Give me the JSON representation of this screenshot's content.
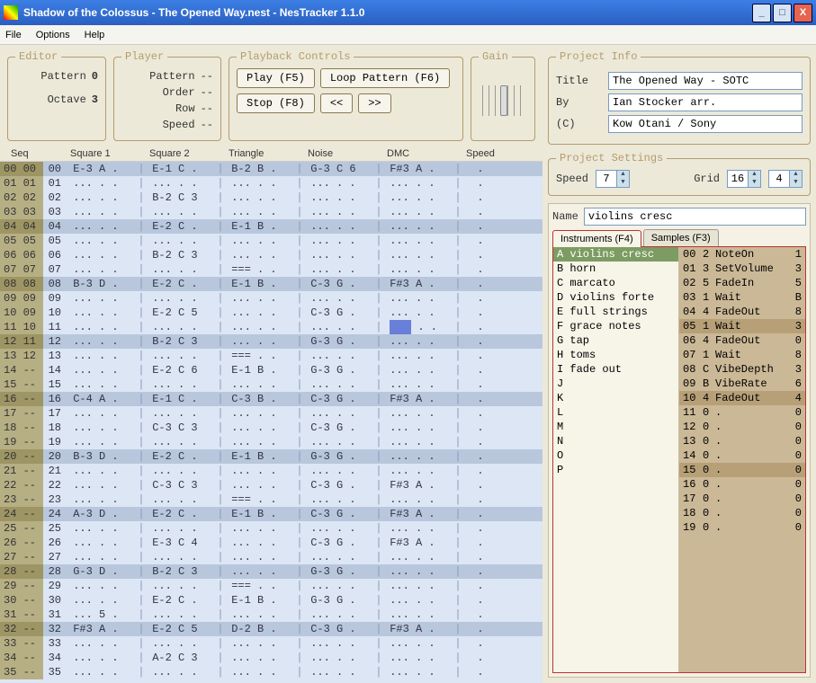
{
  "window": {
    "title": "Shadow of the Colossus - The Opened Way.nest - NesTracker 1.1.0"
  },
  "menu": {
    "file": "File",
    "options": "Options",
    "help": "Help"
  },
  "editor": {
    "legend": "Editor",
    "pattern_lbl": "Pattern",
    "pattern_val": "0",
    "octave_lbl": "Octave",
    "octave_val": "3"
  },
  "player": {
    "legend": "Player",
    "pattern_lbl": "Pattern",
    "pattern_val": "--",
    "order_lbl": "Order",
    "order_val": "--",
    "row_lbl": "Row",
    "row_val": "--",
    "speed_lbl": "Speed",
    "speed_val": "--"
  },
  "playback": {
    "legend": "Playback Controls",
    "play": "Play (F5)",
    "loop": "Loop Pattern (F6)",
    "stop": "Stop (F8)",
    "prev": "<<",
    "next": ">>"
  },
  "gain": {
    "legend": "Gain"
  },
  "columns": {
    "seq": "Seq",
    "sq1": "Square 1",
    "sq2": "Square 2",
    "tri": "Triangle",
    "noise": "Noise",
    "dmc": "DMC",
    "speed": "Speed"
  },
  "rows": [
    {
      "hl": 1,
      "seq": "00 00",
      "idx": "00",
      "sq1": "E-3 A .",
      "sq2": "E-1 C .",
      "tri": "B-2 B .",
      "noi": "G-3 C 6",
      "dmc": "F#3 A .",
      "sp": "."
    },
    {
      "hl": 0,
      "seq": "01 01",
      "idx": "01",
      "sq1": "... . .",
      "sq2": "... . .",
      "tri": "... . .",
      "noi": "... . .",
      "dmc": "... . .",
      "sp": "."
    },
    {
      "hl": 0,
      "seq": "02 02",
      "idx": "02",
      "sq1": "... . .",
      "sq2": "B-2 C 3",
      "tri": "... . .",
      "noi": "... . .",
      "dmc": "... . .",
      "sp": "."
    },
    {
      "hl": 0,
      "seq": "03 03",
      "idx": "03",
      "sq1": "... . .",
      "sq2": "... . .",
      "tri": "... . .",
      "noi": "... . .",
      "dmc": "... . .",
      "sp": "."
    },
    {
      "hl": 1,
      "seq": "04 04",
      "idx": "04",
      "sq1": "... . .",
      "sq2": "E-2 C .",
      "tri": "E-1 B .",
      "noi": "... . .",
      "dmc": "... . .",
      "sp": "."
    },
    {
      "hl": 0,
      "seq": "05 05",
      "idx": "05",
      "sq1": "... . .",
      "sq2": "... . .",
      "tri": "... . .",
      "noi": "... . .",
      "dmc": "... . .",
      "sp": "."
    },
    {
      "hl": 0,
      "seq": "06 06",
      "idx": "06",
      "sq1": "... . .",
      "sq2": "B-2 C 3",
      "tri": "... . .",
      "noi": "... . .",
      "dmc": "... . .",
      "sp": "."
    },
    {
      "hl": 0,
      "seq": "07 07",
      "idx": "07",
      "sq1": "... . .",
      "sq2": "... . .",
      "tri": "=== . .",
      "noi": "... . .",
      "dmc": "... . .",
      "sp": "."
    },
    {
      "hl": 1,
      "seq": "08 08",
      "idx": "08",
      "sq1": "B-3 D .",
      "sq2": "E-2 C .",
      "tri": "E-1 B .",
      "noi": "C-3 G .",
      "dmc": "F#3 A .",
      "sp": "."
    },
    {
      "hl": 0,
      "seq": "09 09",
      "idx": "09",
      "sq1": "... . .",
      "sq2": "... . .",
      "tri": "... . .",
      "noi": "... . .",
      "dmc": "... . .",
      "sp": "."
    },
    {
      "hl": 0,
      "seq": "10 09",
      "idx": "10",
      "sq1": "... . .",
      "sq2": "E-2 C 5",
      "tri": "... . .",
      "noi": "C-3 G .",
      "dmc": "... . .",
      "sp": "."
    },
    {
      "hl": 0,
      "seq": "11 10",
      "idx": "11",
      "sq1": "... . .",
      "sq2": "... . .",
      "tri": "... . .",
      "noi": "... . .",
      "dmc": "CURSOR",
      "sp": "."
    },
    {
      "hl": 1,
      "seq": "12 11",
      "idx": "12",
      "sq1": "... . .",
      "sq2": "B-2 C 3",
      "tri": "... . .",
      "noi": "G-3 G .",
      "dmc": "... . .",
      "sp": "."
    },
    {
      "hl": 0,
      "seq": "13 12",
      "idx": "13",
      "sq1": "... . .",
      "sq2": "... . .",
      "tri": "=== . .",
      "noi": "... . .",
      "dmc": "... . .",
      "sp": "."
    },
    {
      "hl": 0,
      "seq": "14 --",
      "idx": "14",
      "sq1": "... . .",
      "sq2": "E-2 C 6",
      "tri": "E-1 B .",
      "noi": "G-3 G .",
      "dmc": "... . .",
      "sp": "."
    },
    {
      "hl": 0,
      "seq": "15 --",
      "idx": "15",
      "sq1": "... . .",
      "sq2": "... . .",
      "tri": "... . .",
      "noi": "... . .",
      "dmc": "... . .",
      "sp": "."
    },
    {
      "hl": 1,
      "seq": "16 --",
      "idx": "16",
      "sq1": "C-4 A .",
      "sq2": "E-1 C .",
      "tri": "C-3 B .",
      "noi": "C-3 G .",
      "dmc": "F#3 A .",
      "sp": "."
    },
    {
      "hl": 0,
      "seq": "17 --",
      "idx": "17",
      "sq1": "... . .",
      "sq2": "... . .",
      "tri": "... . .",
      "noi": "... . .",
      "dmc": "... . .",
      "sp": "."
    },
    {
      "hl": 0,
      "seq": "18 --",
      "idx": "18",
      "sq1": "... . .",
      "sq2": "C-3 C 3",
      "tri": "... . .",
      "noi": "C-3 G .",
      "dmc": "... . .",
      "sp": "."
    },
    {
      "hl": 0,
      "seq": "19 --",
      "idx": "19",
      "sq1": "... . .",
      "sq2": "... . .",
      "tri": "... . .",
      "noi": "... . .",
      "dmc": "... . .",
      "sp": "."
    },
    {
      "hl": 1,
      "seq": "20 --",
      "idx": "20",
      "sq1": "B-3 D .",
      "sq2": "E-2 C .",
      "tri": "E-1 B .",
      "noi": "G-3 G .",
      "dmc": "... . .",
      "sp": "."
    },
    {
      "hl": 0,
      "seq": "21 --",
      "idx": "21",
      "sq1": "... . .",
      "sq2": "... . .",
      "tri": "... . .",
      "noi": "... . .",
      "dmc": "... . .",
      "sp": "."
    },
    {
      "hl": 0,
      "seq": "22 --",
      "idx": "22",
      "sq1": "... . .",
      "sq2": "C-3 C 3",
      "tri": "... . .",
      "noi": "C-3 G .",
      "dmc": "F#3 A .",
      "sp": "."
    },
    {
      "hl": 0,
      "seq": "23 --",
      "idx": "23",
      "sq1": "... . .",
      "sq2": "... . .",
      "tri": "=== . .",
      "noi": "... . .",
      "dmc": "... . .",
      "sp": "."
    },
    {
      "hl": 1,
      "seq": "24 --",
      "idx": "24",
      "sq1": "A-3 D .",
      "sq2": "E-2 C .",
      "tri": "E-1 B .",
      "noi": "C-3 G .",
      "dmc": "F#3 A .",
      "sp": "."
    },
    {
      "hl": 0,
      "seq": "25 --",
      "idx": "25",
      "sq1": "... . .",
      "sq2": "... . .",
      "tri": "... . .",
      "noi": "... . .",
      "dmc": "... . .",
      "sp": "."
    },
    {
      "hl": 0,
      "seq": "26 --",
      "idx": "26",
      "sq1": "... . .",
      "sq2": "E-3 C 4",
      "tri": "... . .",
      "noi": "C-3 G .",
      "dmc": "F#3 A .",
      "sp": "."
    },
    {
      "hl": 0,
      "seq": "27 --",
      "idx": "27",
      "sq1": "... . .",
      "sq2": "... . .",
      "tri": "... . .",
      "noi": "... . .",
      "dmc": "... . .",
      "sp": "."
    },
    {
      "hl": 1,
      "seq": "28 --",
      "idx": "28",
      "sq1": "G-3 D .",
      "sq2": "B-2 C 3",
      "tri": "... . .",
      "noi": "G-3 G .",
      "dmc": "... . .",
      "sp": "."
    },
    {
      "hl": 0,
      "seq": "29 --",
      "idx": "29",
      "sq1": "... . .",
      "sq2": "... . .",
      "tri": "=== . .",
      "noi": "... . .",
      "dmc": "... . .",
      "sp": "."
    },
    {
      "hl": 0,
      "seq": "30 --",
      "idx": "30",
      "sq1": "... . .",
      "sq2": "E-2 C .",
      "tri": "E-1 B .",
      "noi": "G-3 G .",
      "dmc": "... . .",
      "sp": "."
    },
    {
      "hl": 0,
      "seq": "31 --",
      "idx": "31",
      "sq1": "... 5 .",
      "sq2": "... . .",
      "tri": "... . .",
      "noi": "... . .",
      "dmc": "... . .",
      "sp": "."
    },
    {
      "hl": 1,
      "seq": "32 --",
      "idx": "32",
      "sq1": "F#3 A .",
      "sq2": "E-2 C 5",
      "tri": "D-2 B .",
      "noi": "C-3 G .",
      "dmc": "F#3 A .",
      "sp": "."
    },
    {
      "hl": 0,
      "seq": "33 --",
      "idx": "33",
      "sq1": "... . .",
      "sq2": "... . .",
      "tri": "... . .",
      "noi": "... . .",
      "dmc": "... . .",
      "sp": "."
    },
    {
      "hl": 0,
      "seq": "34 --",
      "idx": "34",
      "sq1": "... . .",
      "sq2": "A-2 C 3",
      "tri": "... . .",
      "noi": "... . .",
      "dmc": "... . .",
      "sp": "."
    },
    {
      "hl": 0,
      "seq": "35 --",
      "idx": "35",
      "sq1": "... . .",
      "sq2": "... . .",
      "tri": "... . .",
      "noi": "... . .",
      "dmc": "... . .",
      "sp": "."
    }
  ],
  "project": {
    "legend": "Project Info",
    "title_lbl": "Title",
    "title_val": "The Opened Way - SOTC",
    "by_lbl": "By",
    "by_val": "Ian Stocker arr.",
    "c_lbl": "(C)",
    "c_val": "Kow Otani / Sony"
  },
  "settings": {
    "legend": "Project Settings",
    "speed_lbl": "Speed",
    "speed_val": "7",
    "grid_lbl": "Grid",
    "grid_a": "16",
    "grid_b": "4"
  },
  "instr": {
    "name_lbl": "Name",
    "name_val": "violins cresc",
    "tab_instr": "Instruments (F4)",
    "tab_samp": "Samples (F3)",
    "list": [
      {
        "k": "A",
        "n": "violins cresc",
        "sel": 1
      },
      {
        "k": "B",
        "n": "horn"
      },
      {
        "k": "C",
        "n": "marcato"
      },
      {
        "k": "D",
        "n": "violins forte"
      },
      {
        "k": "E",
        "n": "full strings"
      },
      {
        "k": "F",
        "n": "grace notes"
      },
      {
        "k": "G",
        "n": "tap"
      },
      {
        "k": "H",
        "n": "toms"
      },
      {
        "k": "I",
        "n": "fade out"
      },
      {
        "k": "J",
        "n": ""
      },
      {
        "k": "K",
        "n": ""
      },
      {
        "k": "L",
        "n": ""
      },
      {
        "k": "M",
        "n": ""
      },
      {
        "k": "N",
        "n": ""
      },
      {
        "k": "O",
        "n": ""
      },
      {
        "k": "P",
        "n": ""
      }
    ],
    "macro": [
      {
        "i": "00",
        "a": "2",
        "cmd": "NoteOn",
        "v": "1"
      },
      {
        "i": "01",
        "a": "3",
        "cmd": "SetVolume",
        "v": "3"
      },
      {
        "i": "02",
        "a": "5",
        "cmd": "FadeIn",
        "v": "5"
      },
      {
        "i": "03",
        "a": "1",
        "cmd": "Wait",
        "v": "B"
      },
      {
        "i": "04",
        "a": "4",
        "cmd": "FadeOut",
        "v": "8"
      },
      {
        "i": "05",
        "a": "1",
        "cmd": "Wait",
        "v": "3",
        "alt": 1
      },
      {
        "i": "06",
        "a": "4",
        "cmd": "FadeOut",
        "v": "0"
      },
      {
        "i": "07",
        "a": "1",
        "cmd": "Wait",
        "v": "8"
      },
      {
        "i": "08",
        "a": "C",
        "cmd": "VibeDepth",
        "v": "3"
      },
      {
        "i": "09",
        "a": "B",
        "cmd": "VibeRate",
        "v": "6"
      },
      {
        "i": "10",
        "a": "4",
        "cmd": "FadeOut",
        "v": "4",
        "alt": 1
      },
      {
        "i": "11",
        "a": "0",
        "cmd": ".",
        "v": "0"
      },
      {
        "i": "12",
        "a": "0",
        "cmd": ".",
        "v": "0"
      },
      {
        "i": "13",
        "a": "0",
        "cmd": ".",
        "v": "0"
      },
      {
        "i": "14",
        "a": "0",
        "cmd": ".",
        "v": "0"
      },
      {
        "i": "15",
        "a": "0",
        "cmd": ".",
        "v": "0",
        "alt": 1
      },
      {
        "i": "16",
        "a": "0",
        "cmd": ".",
        "v": "0"
      },
      {
        "i": "17",
        "a": "0",
        "cmd": ".",
        "v": "0"
      },
      {
        "i": "18",
        "a": "0",
        "cmd": ".",
        "v": "0"
      },
      {
        "i": "19",
        "a": "0",
        "cmd": ".",
        "v": "0"
      }
    ]
  }
}
